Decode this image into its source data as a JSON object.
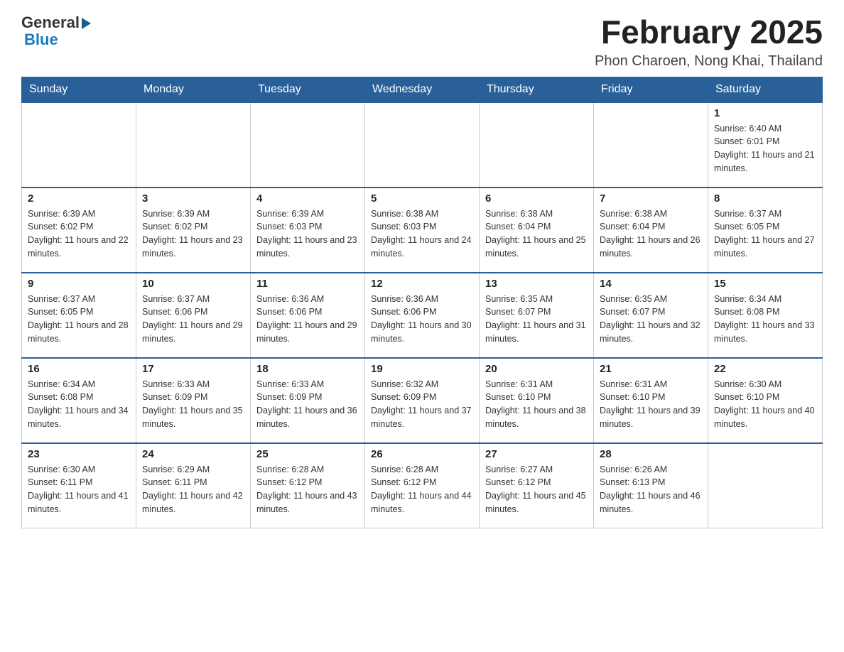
{
  "header": {
    "logo_general": "General",
    "logo_blue": "Blue",
    "month_title": "February 2025",
    "location": "Phon Charoen, Nong Khai, Thailand"
  },
  "days_of_week": [
    "Sunday",
    "Monday",
    "Tuesday",
    "Wednesday",
    "Thursday",
    "Friday",
    "Saturday"
  ],
  "weeks": [
    {
      "days": [
        {
          "date": "",
          "sunrise": "",
          "sunset": "",
          "daylight": ""
        },
        {
          "date": "",
          "sunrise": "",
          "sunset": "",
          "daylight": ""
        },
        {
          "date": "",
          "sunrise": "",
          "sunset": "",
          "daylight": ""
        },
        {
          "date": "",
          "sunrise": "",
          "sunset": "",
          "daylight": ""
        },
        {
          "date": "",
          "sunrise": "",
          "sunset": "",
          "daylight": ""
        },
        {
          "date": "",
          "sunrise": "",
          "sunset": "",
          "daylight": ""
        },
        {
          "date": "1",
          "sunrise": "Sunrise: 6:40 AM",
          "sunset": "Sunset: 6:01 PM",
          "daylight": "Daylight: 11 hours and 21 minutes."
        }
      ]
    },
    {
      "days": [
        {
          "date": "2",
          "sunrise": "Sunrise: 6:39 AM",
          "sunset": "Sunset: 6:02 PM",
          "daylight": "Daylight: 11 hours and 22 minutes."
        },
        {
          "date": "3",
          "sunrise": "Sunrise: 6:39 AM",
          "sunset": "Sunset: 6:02 PM",
          "daylight": "Daylight: 11 hours and 23 minutes."
        },
        {
          "date": "4",
          "sunrise": "Sunrise: 6:39 AM",
          "sunset": "Sunset: 6:03 PM",
          "daylight": "Daylight: 11 hours and 23 minutes."
        },
        {
          "date": "5",
          "sunrise": "Sunrise: 6:38 AM",
          "sunset": "Sunset: 6:03 PM",
          "daylight": "Daylight: 11 hours and 24 minutes."
        },
        {
          "date": "6",
          "sunrise": "Sunrise: 6:38 AM",
          "sunset": "Sunset: 6:04 PM",
          "daylight": "Daylight: 11 hours and 25 minutes."
        },
        {
          "date": "7",
          "sunrise": "Sunrise: 6:38 AM",
          "sunset": "Sunset: 6:04 PM",
          "daylight": "Daylight: 11 hours and 26 minutes."
        },
        {
          "date": "8",
          "sunrise": "Sunrise: 6:37 AM",
          "sunset": "Sunset: 6:05 PM",
          "daylight": "Daylight: 11 hours and 27 minutes."
        }
      ]
    },
    {
      "days": [
        {
          "date": "9",
          "sunrise": "Sunrise: 6:37 AM",
          "sunset": "Sunset: 6:05 PM",
          "daylight": "Daylight: 11 hours and 28 minutes."
        },
        {
          "date": "10",
          "sunrise": "Sunrise: 6:37 AM",
          "sunset": "Sunset: 6:06 PM",
          "daylight": "Daylight: 11 hours and 29 minutes."
        },
        {
          "date": "11",
          "sunrise": "Sunrise: 6:36 AM",
          "sunset": "Sunset: 6:06 PM",
          "daylight": "Daylight: 11 hours and 29 minutes."
        },
        {
          "date": "12",
          "sunrise": "Sunrise: 6:36 AM",
          "sunset": "Sunset: 6:06 PM",
          "daylight": "Daylight: 11 hours and 30 minutes."
        },
        {
          "date": "13",
          "sunrise": "Sunrise: 6:35 AM",
          "sunset": "Sunset: 6:07 PM",
          "daylight": "Daylight: 11 hours and 31 minutes."
        },
        {
          "date": "14",
          "sunrise": "Sunrise: 6:35 AM",
          "sunset": "Sunset: 6:07 PM",
          "daylight": "Daylight: 11 hours and 32 minutes."
        },
        {
          "date": "15",
          "sunrise": "Sunrise: 6:34 AM",
          "sunset": "Sunset: 6:08 PM",
          "daylight": "Daylight: 11 hours and 33 minutes."
        }
      ]
    },
    {
      "days": [
        {
          "date": "16",
          "sunrise": "Sunrise: 6:34 AM",
          "sunset": "Sunset: 6:08 PM",
          "daylight": "Daylight: 11 hours and 34 minutes."
        },
        {
          "date": "17",
          "sunrise": "Sunrise: 6:33 AM",
          "sunset": "Sunset: 6:09 PM",
          "daylight": "Daylight: 11 hours and 35 minutes."
        },
        {
          "date": "18",
          "sunrise": "Sunrise: 6:33 AM",
          "sunset": "Sunset: 6:09 PM",
          "daylight": "Daylight: 11 hours and 36 minutes."
        },
        {
          "date": "19",
          "sunrise": "Sunrise: 6:32 AM",
          "sunset": "Sunset: 6:09 PM",
          "daylight": "Daylight: 11 hours and 37 minutes."
        },
        {
          "date": "20",
          "sunrise": "Sunrise: 6:31 AM",
          "sunset": "Sunset: 6:10 PM",
          "daylight": "Daylight: 11 hours and 38 minutes."
        },
        {
          "date": "21",
          "sunrise": "Sunrise: 6:31 AM",
          "sunset": "Sunset: 6:10 PM",
          "daylight": "Daylight: 11 hours and 39 minutes."
        },
        {
          "date": "22",
          "sunrise": "Sunrise: 6:30 AM",
          "sunset": "Sunset: 6:10 PM",
          "daylight": "Daylight: 11 hours and 40 minutes."
        }
      ]
    },
    {
      "days": [
        {
          "date": "23",
          "sunrise": "Sunrise: 6:30 AM",
          "sunset": "Sunset: 6:11 PM",
          "daylight": "Daylight: 11 hours and 41 minutes."
        },
        {
          "date": "24",
          "sunrise": "Sunrise: 6:29 AM",
          "sunset": "Sunset: 6:11 PM",
          "daylight": "Daylight: 11 hours and 42 minutes."
        },
        {
          "date": "25",
          "sunrise": "Sunrise: 6:28 AM",
          "sunset": "Sunset: 6:12 PM",
          "daylight": "Daylight: 11 hours and 43 minutes."
        },
        {
          "date": "26",
          "sunrise": "Sunrise: 6:28 AM",
          "sunset": "Sunset: 6:12 PM",
          "daylight": "Daylight: 11 hours and 44 minutes."
        },
        {
          "date": "27",
          "sunrise": "Sunrise: 6:27 AM",
          "sunset": "Sunset: 6:12 PM",
          "daylight": "Daylight: 11 hours and 45 minutes."
        },
        {
          "date": "28",
          "sunrise": "Sunrise: 6:26 AM",
          "sunset": "Sunset: 6:13 PM",
          "daylight": "Daylight: 11 hours and 46 minutes."
        },
        {
          "date": "",
          "sunrise": "",
          "sunset": "",
          "daylight": ""
        }
      ]
    }
  ]
}
